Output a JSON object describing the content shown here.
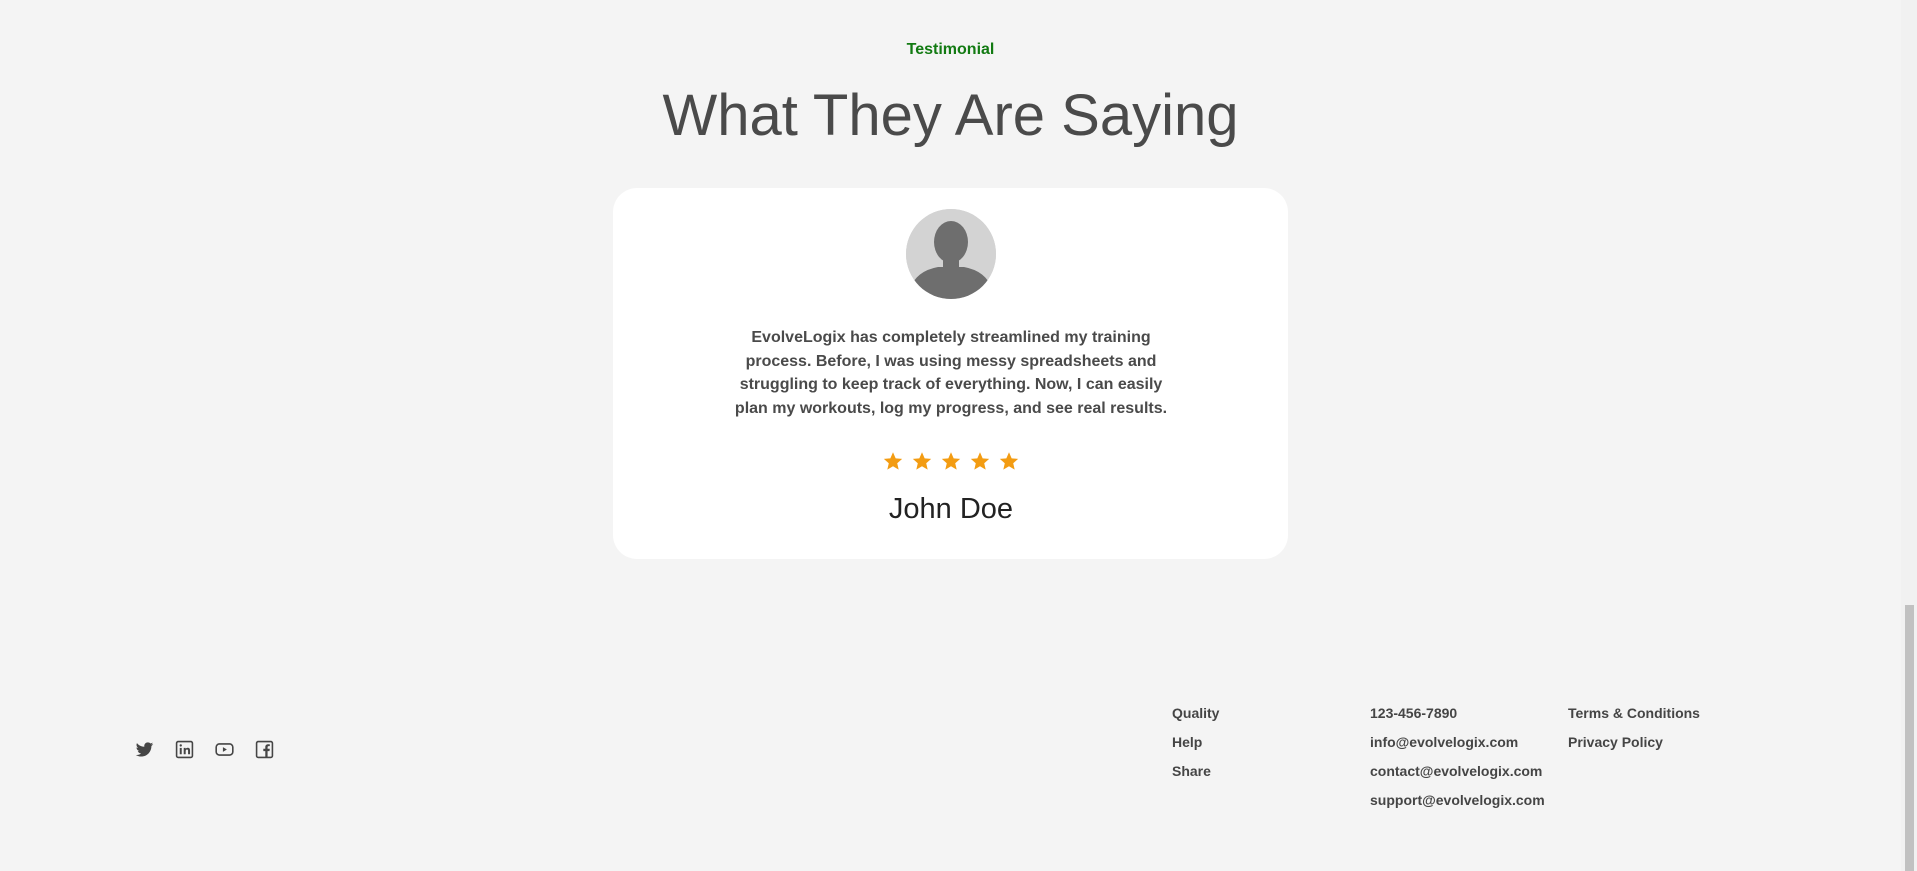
{
  "testimonial_section": {
    "eyebrow": "Testimonial",
    "headline": "What They Are Saying",
    "card": {
      "avatar_icon": "user-silhouette-icon",
      "quote": "EvolveLogix has completely streamlined my training process. Before, I was using messy spreadsheets and struggling to keep track of everything. Now, I can easily plan my workouts, log my progress, and see real results.",
      "rating": 5,
      "rating_max": 5,
      "star_color": "#f39c12",
      "author": "John Doe"
    }
  },
  "footer": {
    "social": [
      {
        "icon": "twitter-icon"
      },
      {
        "icon": "linkedin-icon"
      },
      {
        "icon": "youtube-icon"
      },
      {
        "icon": "facebook-icon"
      }
    ],
    "links_col1": [
      "Quality",
      "Help",
      "Share"
    ],
    "contacts": [
      "123-456-7890",
      "info@evolvelogix.com",
      "contact@evolvelogix.com",
      "support@evolvelogix.com"
    ],
    "legal": [
      "Terms & Conditions",
      "Privacy Policy"
    ]
  },
  "colors": {
    "accent": "#127a12",
    "background": "#f4f4f4",
    "card": "#ffffff"
  }
}
